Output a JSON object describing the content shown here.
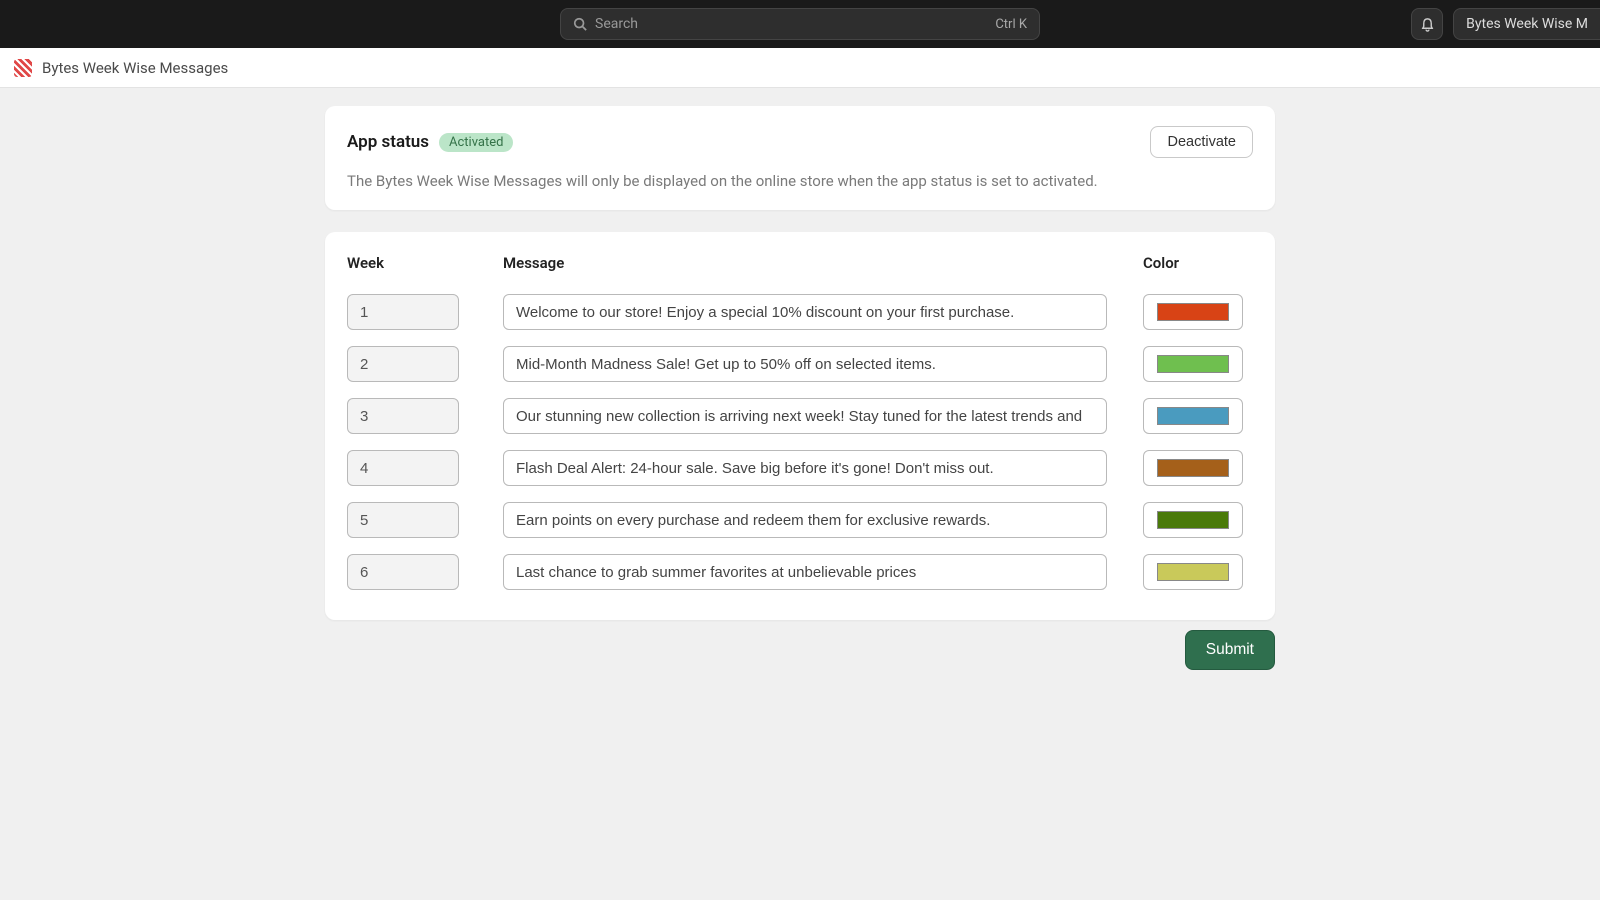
{
  "topbar": {
    "search_placeholder": "Search",
    "search_shortcut": "Ctrl K",
    "account_label": "Bytes Week Wise M"
  },
  "breadcrumb": {
    "app_name": "Bytes Week Wise Messages"
  },
  "status": {
    "title": "App status",
    "badge": "Activated",
    "deactivate_label": "Deactivate",
    "description": "The Bytes Week Wise Messages will only be displayed on the online store when the app status is set to activated."
  },
  "table": {
    "headers": {
      "week": "Week",
      "message": "Message",
      "color": "Color"
    },
    "rows": [
      {
        "week": "1",
        "message": "Welcome to our store! Enjoy a special 10% discount on your first purchase.",
        "color": "#d84315"
      },
      {
        "week": "2",
        "message": "Mid-Month Madness Sale! Get up to 50% off on selected items.",
        "color": "#6fbf4f"
      },
      {
        "week": "3",
        "message": "Our stunning new collection is arriving next week! Stay tuned for the latest trends and",
        "color": "#4a9bbf"
      },
      {
        "week": "4",
        "message": "Flash Deal Alert: 24-hour sale. Save big before it's gone! Don't miss out.",
        "color": "#a5601a"
      },
      {
        "week": "5",
        "message": "Earn points on every purchase and redeem them for exclusive rewards.",
        "color": "#4a7a0a"
      },
      {
        "week": "6",
        "message": "Last chance to grab summer favorites at unbelievable prices",
        "color": "#c9c95a"
      }
    ]
  },
  "submit_label": "Submit"
}
